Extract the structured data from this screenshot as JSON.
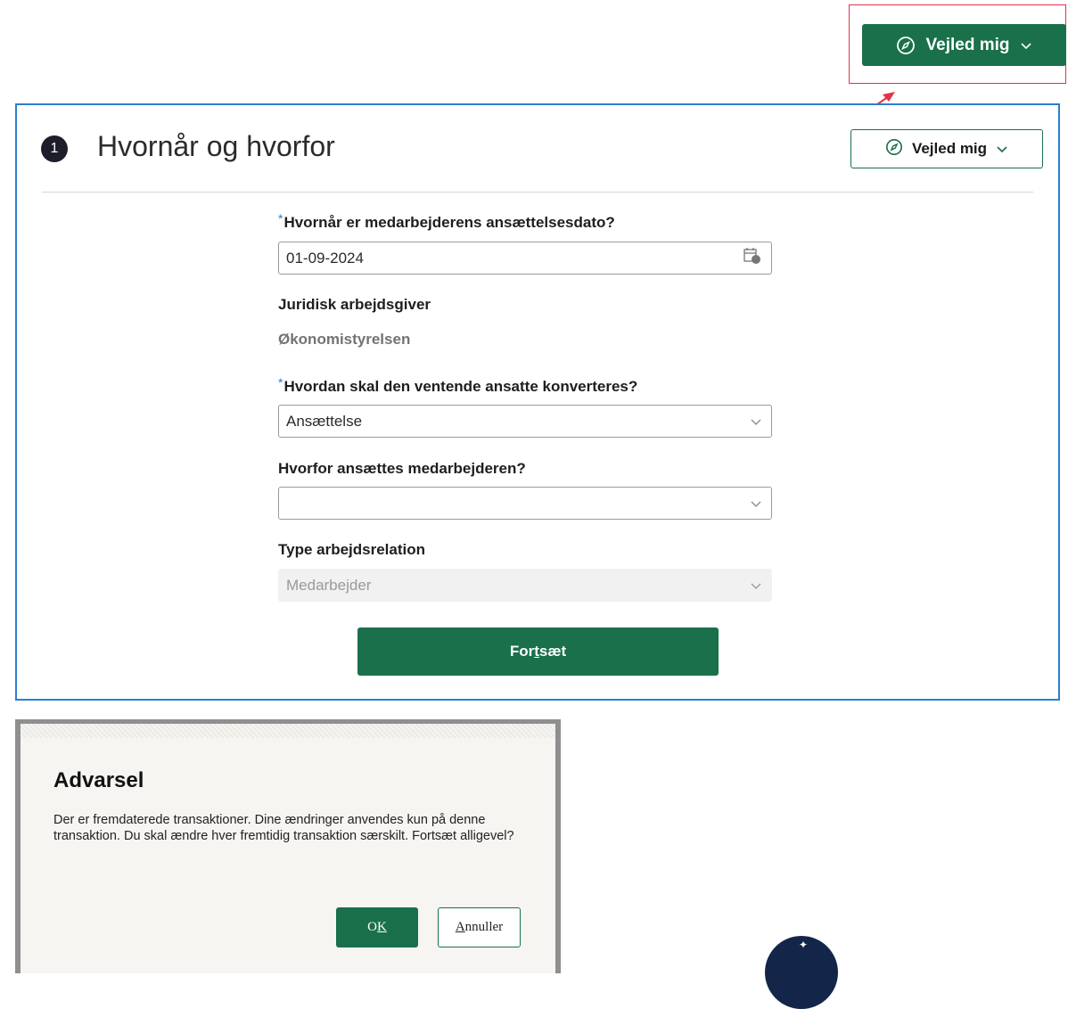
{
  "callout": {
    "button_label": "Vejled mig",
    "highlight_color": "#e0344a",
    "arrow_color": "#e0344a"
  },
  "section": {
    "step_number": "1",
    "title": "Hvornår og hvorfor",
    "guide_button_label": "Vejled mig"
  },
  "form": {
    "hire_date": {
      "label": "Hvornår er medarbejderens ansættelsesdato?",
      "required_marker": "*",
      "value": "01-09-2024"
    },
    "legal_employer": {
      "label": "Juridisk arbejdsgiver",
      "value": "Økonomistyrelsen"
    },
    "conversion": {
      "label": "Hvordan skal den ventende ansatte konverteres?",
      "required_marker": "*",
      "value": "Ansættelse"
    },
    "reason": {
      "label": "Hvorfor ansættes medarbejderen?",
      "value": ""
    },
    "work_relation_type": {
      "label": "Type arbejdsrelation",
      "value": "Medarbejder"
    },
    "continue_button": {
      "pre": "For",
      "mnemonic": "t",
      "post": "sæt"
    }
  },
  "dialog": {
    "title": "Advarsel",
    "message": "Der er fremdaterede transaktioner. Dine ændringer anvendes kun på denne transaktion. Du skal ændre hver fremtidig transaktion særskilt. Fortsæt alligevel?",
    "ok_pre": "O",
    "ok_mnemonic": "K",
    "cancel_mnemonic": "A",
    "cancel_post": "nnuller"
  },
  "colors": {
    "brand_green": "#19704a",
    "panel_border": "#2a7fd0",
    "step_circle": "#1d1d2b",
    "chat_bubble": "#14254a"
  }
}
